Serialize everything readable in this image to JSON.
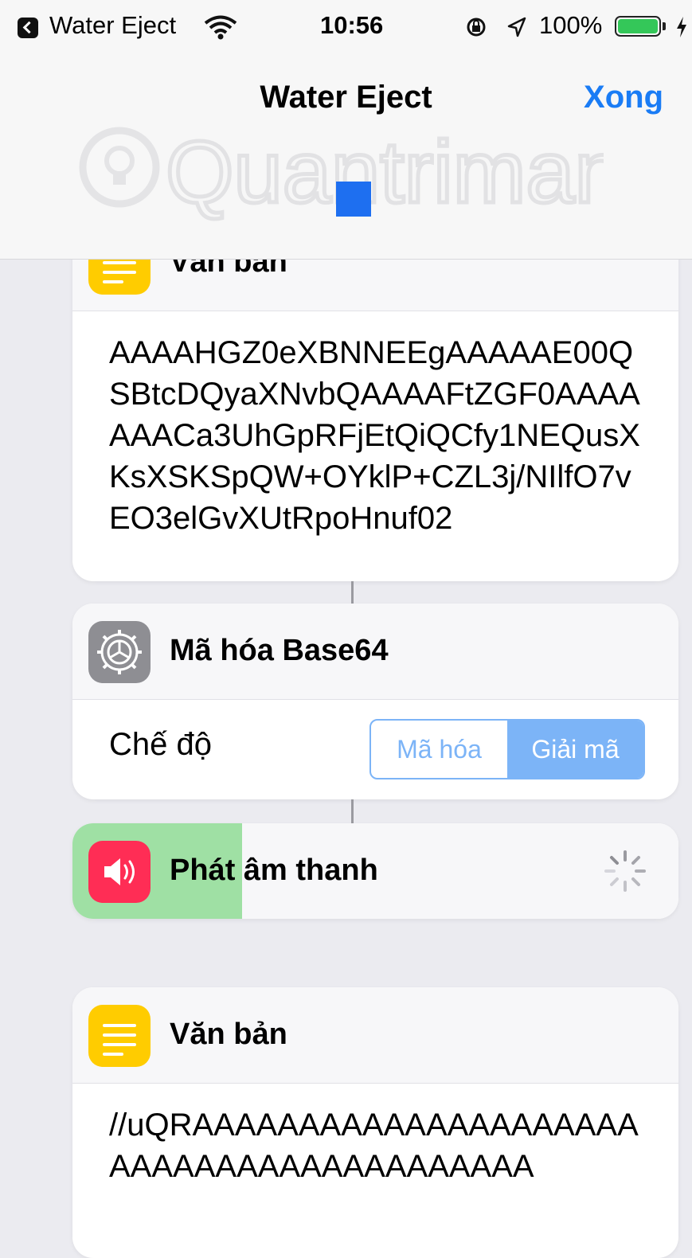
{
  "status_bar": {
    "back_app": "Water Eject",
    "time": "10:56",
    "battery": "100%",
    "battery_level": 1.0,
    "icons": [
      "back-arrow-icon",
      "wifi-icon",
      "orientation-lock-icon",
      "location-icon",
      "battery-icon",
      "charging-bolt-icon"
    ]
  },
  "nav": {
    "title": "Water Eject",
    "done_label": "Xong"
  },
  "watermark": "Quantrimang",
  "actions": [
    {
      "title": "Văn bản",
      "icon": "text-icon",
      "text": "AAAAHGZ0eXBNNEEgAAAAAE00QSBtcDQyaXNvbQAAAAFtZGF0AAAAAAACa3UhGpRFjEtQiQCfy1NEQusXKsXSKSpQW+OYklP+CZL3j/NIlfO7vEO3elGvXUtRpoHnuf02"
    },
    {
      "title": "Mã hóa Base64",
      "icon": "gear-icon",
      "mode_label": "Chế độ",
      "mode_options": [
        "Mã hóa",
        "Giải mã"
      ],
      "selected_mode": "Giải mã"
    },
    {
      "title": "Phát âm thanh",
      "icon": "speaker-icon",
      "progress": 0.28
    },
    {
      "title": "Văn bản",
      "icon": "text-icon",
      "text": "//uQRAAAAAAAAAAAAAAAAAAAAAAAAAAAAAAAAAAAAAAAAA"
    }
  ],
  "colors": {
    "accent": "#1a7cf5",
    "segment": "#7cb4f7",
    "text_icon": "#ffcc00",
    "settings_icon": "#8e8e93",
    "sound_icon": "#ff2d55",
    "progress": "#9fe0a4",
    "battery": "#34c759"
  }
}
